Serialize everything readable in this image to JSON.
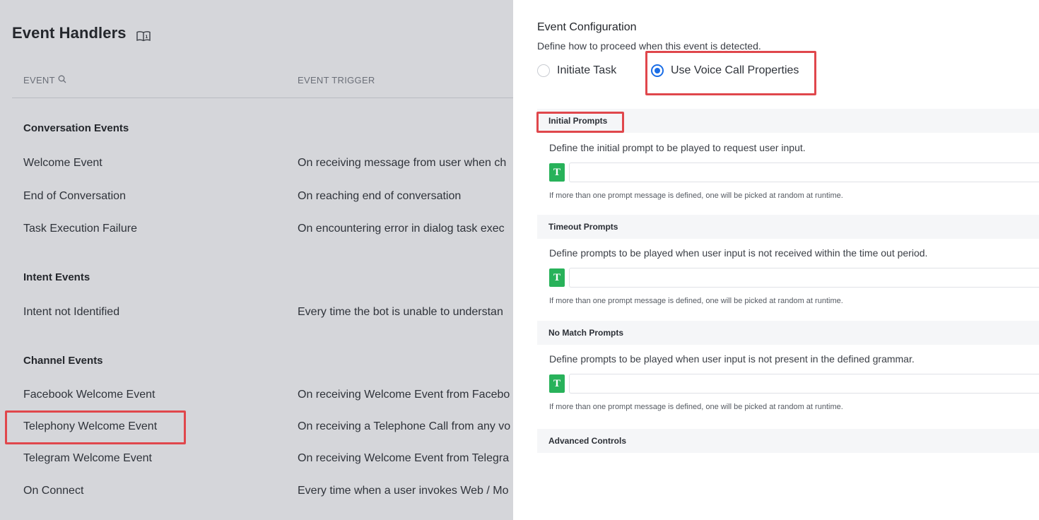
{
  "left": {
    "title": "Event Handlers",
    "columns": {
      "event": "EVENT",
      "trigger": "EVENT TRIGGER"
    },
    "groups": [
      {
        "title": "Conversation Events",
        "rows": [
          {
            "name": "Welcome Event",
            "trigger": "On receiving message from user when ch"
          },
          {
            "name": "End of Conversation",
            "trigger": "On reaching end of conversation"
          },
          {
            "name": "Task Execution Failure",
            "trigger": "On encountering error in dialog task exec"
          }
        ]
      },
      {
        "title": "Intent Events",
        "rows": [
          {
            "name": "Intent not Identified",
            "trigger": "Every time the bot is unable to understan"
          }
        ]
      },
      {
        "title": "Channel Events",
        "rows": [
          {
            "name": "Facebook Welcome Event",
            "trigger": "On receiving Welcome Event from Facebo"
          },
          {
            "name": "Telephony Welcome Event",
            "trigger": "On receiving a Telephone Call from any vo"
          },
          {
            "name": "Telegram Welcome Event",
            "trigger": "On receiving Welcome Event from Telegra"
          },
          {
            "name": "On Connect",
            "trigger": "Every time when a user invokes Web / Mo"
          }
        ]
      }
    ]
  },
  "right": {
    "title": "Event Configuration",
    "description": "Define how to proceed when this event is detected.",
    "options": [
      {
        "label": "Initiate Task",
        "selected": false
      },
      {
        "label": "Use Voice Call Properties",
        "selected": true
      }
    ],
    "sections": [
      {
        "title": "Initial Prompts",
        "description": "Define the initial prompt to be played to request user input.",
        "hint": "If more than one prompt message is defined, one will be picked at random at runtime.",
        "prompt_value": ""
      },
      {
        "title": "Timeout Prompts",
        "description": "Define prompts to be played when user input is not received within the time out period.",
        "hint": "If more than one prompt message is defined, one will be picked at random at runtime.",
        "prompt_value": ""
      },
      {
        "title": "No Match Prompts",
        "description": "Define prompts to be played when user input is not present in the defined grammar.",
        "hint": "If more than one prompt message is defined, one will be picked at random at runtime.",
        "prompt_value": ""
      }
    ],
    "advanced": "Advanced Controls",
    "text_prompt_icon": "T"
  },
  "icons": {
    "book": "book-icon",
    "search": "search-icon",
    "text_prompt": "text-prompt-icon"
  },
  "colors": {
    "highlight": "#e0474c",
    "radio_selected": "#1a6de6",
    "prompt_icon": "#28b25a",
    "overlay": "#d5d6da"
  }
}
